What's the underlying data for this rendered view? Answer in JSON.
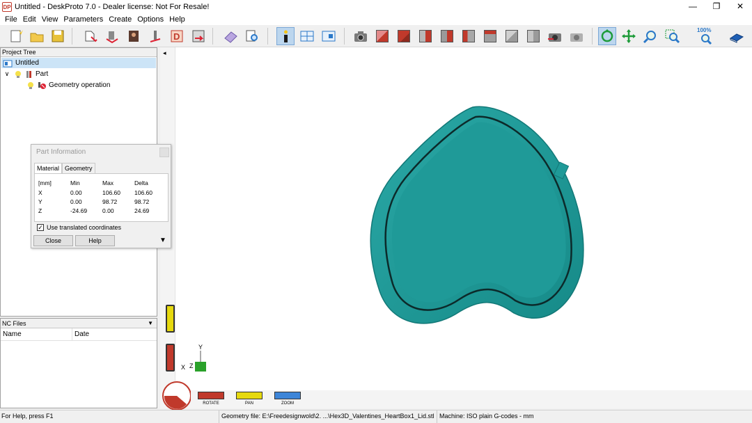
{
  "window": {
    "logo_text": "DP",
    "title": "Untitled - DeskProto 7.0 - Dealer license: Not For Resale!",
    "minimize": "—",
    "restore": "❐",
    "close": "✕"
  },
  "menu": [
    "File",
    "Edit",
    "View",
    "Parameters",
    "Create",
    "Options",
    "Help"
  ],
  "toolbar": {
    "zoom_label": "100%"
  },
  "project_tree": {
    "header": "Project Tree",
    "items": [
      {
        "label": "Untitled"
      },
      {
        "label": "Part"
      },
      {
        "label": "Geometry operation"
      }
    ],
    "expander": "∨",
    "collapse_arrow": "◂"
  },
  "nc_files": {
    "header": "NC Files",
    "dropdown": "▼",
    "columns": [
      "Name",
      "Date"
    ]
  },
  "part_info": {
    "title": "Part Information",
    "tabs": [
      "Material",
      "Geometry"
    ],
    "headers": [
      "[mm]",
      "Min",
      "Max",
      "Delta"
    ],
    "rows": [
      {
        "axis": "X",
        "min": "0.00",
        "max": "106.60",
        "delta": "106.60"
      },
      {
        "axis": "Y",
        "min": "0.00",
        "max": "98.72",
        "delta": "98.72"
      },
      {
        "axis": "Z",
        "min": "-24.69",
        "max": "0.00",
        "delta": "24.69"
      }
    ],
    "checkbox_label": "Use translated coordinates",
    "checkbox_mark": "✓",
    "close_label": "Close",
    "help_label": "Help",
    "more_arrow": "▼"
  },
  "viewport": {
    "axis_y": "Y",
    "axis_x": "X",
    "axis_z": "Z",
    "modes": [
      "ROTATE",
      "PAN",
      "ZOOM"
    ],
    "model_color": "#1f9a98"
  },
  "status": {
    "help": "For Help, press F1",
    "geometry": "Geometry file: E:\\Freedesignwold\\2. ...\\Hex3D_Valentines_HeartBox1_Lid.stl",
    "machine": "Machine: ISO plain G-codes - mm"
  }
}
